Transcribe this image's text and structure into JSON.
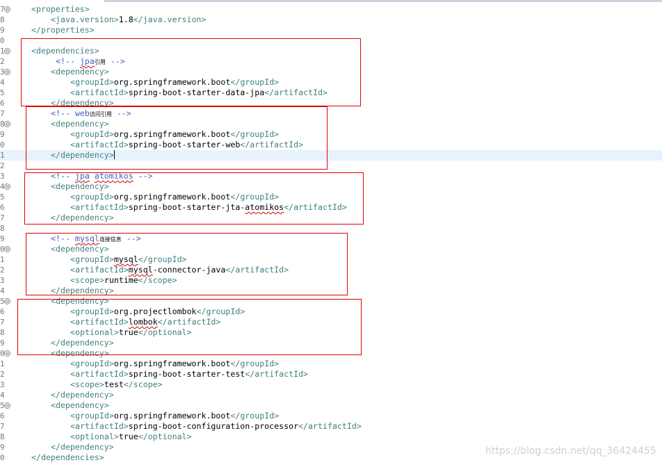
{
  "lines": [
    {
      "ln": "7",
      "fold": true,
      "indent": 0,
      "parts": [
        {
          "k": "tg",
          "t": "<properties>"
        }
      ]
    },
    {
      "ln": "8",
      "indent": 2,
      "parts": [
        {
          "k": "tg",
          "t": "<java.version>"
        },
        {
          "k": "tx",
          "t": "1.8"
        },
        {
          "k": "tg",
          "t": "</java.version>"
        }
      ]
    },
    {
      "ln": "9",
      "indent": 0,
      "parts": [
        {
          "k": "tg",
          "t": "</properties>"
        }
      ]
    },
    {
      "ln": "0",
      "indent": 0,
      "parts": []
    },
    {
      "ln": "1",
      "fold": true,
      "indent": 0,
      "parts": [
        {
          "k": "tg",
          "t": "<dependencies>"
        }
      ]
    },
    {
      "ln": "2",
      "indent": 2.5,
      "parts": [
        {
          "k": "cm",
          "t": "<!-- "
        },
        {
          "k": "cm",
          "t": "jpa",
          "spell": true
        },
        {
          "k": "cj",
          "t": "引用"
        },
        {
          "k": "cm",
          "t": " -->"
        }
      ]
    },
    {
      "ln": "3",
      "fold": true,
      "indent": 2,
      "parts": [
        {
          "k": "tg",
          "t": "<dependency>"
        }
      ]
    },
    {
      "ln": "4",
      "indent": 4,
      "parts": [
        {
          "k": "tg",
          "t": "<groupId>"
        },
        {
          "k": "tx",
          "t": "org.springframework.boot"
        },
        {
          "k": "tg",
          "t": "</groupId>"
        }
      ]
    },
    {
      "ln": "5",
      "indent": 4,
      "parts": [
        {
          "k": "tg",
          "t": "<artifactId>"
        },
        {
          "k": "tx",
          "t": "spring-boot-starter-data-jpa"
        },
        {
          "k": "tg",
          "t": "</artifactId>"
        }
      ]
    },
    {
      "ln": "6",
      "indent": 2,
      "parts": [
        {
          "k": "tg",
          "t": "</dependency>"
        }
      ]
    },
    {
      "ln": "7",
      "indent": 2,
      "parts": [
        {
          "k": "cm",
          "t": "<!-- web"
        },
        {
          "k": "cj",
          "t": "访问引用"
        },
        {
          "k": "cm",
          "t": " -->"
        }
      ]
    },
    {
      "ln": "8",
      "fold": true,
      "indent": 2,
      "parts": [
        {
          "k": "tg",
          "t": "<dependency>"
        }
      ]
    },
    {
      "ln": "9",
      "indent": 4,
      "parts": [
        {
          "k": "tg",
          "t": "<groupId>"
        },
        {
          "k": "tx",
          "t": "org.springframework.boot"
        },
        {
          "k": "tg",
          "t": "</groupId>"
        }
      ]
    },
    {
      "ln": "0",
      "indent": 4,
      "parts": [
        {
          "k": "tg",
          "t": "<artifactId>"
        },
        {
          "k": "tx",
          "t": "spring-boot-starter-web"
        },
        {
          "k": "tg",
          "t": "</artifactId>"
        }
      ]
    },
    {
      "ln": "1",
      "indent": 2,
      "current": true,
      "caret": true,
      "parts": [
        {
          "k": "tg",
          "t": "</dependency>"
        }
      ]
    },
    {
      "ln": "2",
      "indent": 0,
      "parts": []
    },
    {
      "ln": "3",
      "indent": 2,
      "parts": [
        {
          "k": "cm",
          "t": "<!-- "
        },
        {
          "k": "cm",
          "t": "jpa",
          "spell": true
        },
        {
          "k": "cm",
          "t": " "
        },
        {
          "k": "cm",
          "t": "atomikos",
          "spell": true
        },
        {
          "k": "cm",
          "t": " -->"
        }
      ]
    },
    {
      "ln": "4",
      "fold": true,
      "indent": 2,
      "parts": [
        {
          "k": "tg",
          "t": "<dependency>"
        }
      ]
    },
    {
      "ln": "5",
      "indent": 4,
      "parts": [
        {
          "k": "tg",
          "t": "<groupId>"
        },
        {
          "k": "tx",
          "t": "org.springframework.boot"
        },
        {
          "k": "tg",
          "t": "</groupId>"
        }
      ]
    },
    {
      "ln": "6",
      "indent": 4,
      "parts": [
        {
          "k": "tg",
          "t": "<artifactId>"
        },
        {
          "k": "tx",
          "t": "spring-boot-starter-jta-"
        },
        {
          "k": "tx",
          "t": "atomikos",
          "spell": true
        },
        {
          "k": "tg",
          "t": "</artifactId>"
        }
      ]
    },
    {
      "ln": "7",
      "indent": 2,
      "parts": [
        {
          "k": "tg",
          "t": "</dependency>"
        }
      ]
    },
    {
      "ln": "8",
      "indent": 0,
      "parts": []
    },
    {
      "ln": "9",
      "indent": 2,
      "parts": [
        {
          "k": "cm",
          "t": "<!-- "
        },
        {
          "k": "cm",
          "t": "mysql",
          "spell": true
        },
        {
          "k": "cj",
          "t": "连接信息"
        },
        {
          "k": "cm",
          "t": " -->"
        }
      ]
    },
    {
      "ln": "0",
      "fold": true,
      "indent": 2,
      "parts": [
        {
          "k": "tg",
          "t": "<dependency>"
        }
      ]
    },
    {
      "ln": "1",
      "indent": 4,
      "parts": [
        {
          "k": "tg",
          "t": "<groupId>"
        },
        {
          "k": "tx",
          "t": "mysql",
          "spell": true
        },
        {
          "k": "tg",
          "t": "</groupId>"
        }
      ]
    },
    {
      "ln": "2",
      "indent": 4,
      "parts": [
        {
          "k": "tg",
          "t": "<artifactId>"
        },
        {
          "k": "tx",
          "t": "mysql",
          "spell": true
        },
        {
          "k": "tx",
          "t": "-connector-java"
        },
        {
          "k": "tg",
          "t": "</artifactId>"
        }
      ]
    },
    {
      "ln": "3",
      "indent": 4,
      "parts": [
        {
          "k": "tg",
          "t": "<scope>"
        },
        {
          "k": "tx",
          "t": "runtime"
        },
        {
          "k": "tg",
          "t": "</scope>"
        }
      ]
    },
    {
      "ln": "4",
      "indent": 2,
      "parts": [
        {
          "k": "tg",
          "t": "</dependency>"
        }
      ]
    },
    {
      "ln": "5",
      "fold": true,
      "indent": 2,
      "parts": [
        {
          "k": "tg",
          "t": "<dependency>"
        }
      ]
    },
    {
      "ln": "6",
      "indent": 4,
      "parts": [
        {
          "k": "tg",
          "t": "<groupId>"
        },
        {
          "k": "tx",
          "t": "org.projectlombok"
        },
        {
          "k": "tg",
          "t": "</groupId>"
        }
      ]
    },
    {
      "ln": "7",
      "indent": 4,
      "parts": [
        {
          "k": "tg",
          "t": "<artifactId>"
        },
        {
          "k": "tx",
          "t": "lombok",
          "spell": true
        },
        {
          "k": "tg",
          "t": "</artifactId>"
        }
      ]
    },
    {
      "ln": "8",
      "indent": 4,
      "parts": [
        {
          "k": "tg",
          "t": "<optional>"
        },
        {
          "k": "tx",
          "t": "true"
        },
        {
          "k": "tg",
          "t": "</optional>"
        }
      ]
    },
    {
      "ln": "9",
      "indent": 2,
      "parts": [
        {
          "k": "tg",
          "t": "</dependency>"
        }
      ]
    },
    {
      "ln": "0",
      "fold": true,
      "indent": 2,
      "parts": [
        {
          "k": "tg",
          "t": "<dependency>"
        }
      ]
    },
    {
      "ln": "1",
      "indent": 4,
      "parts": [
        {
          "k": "tg",
          "t": "<groupId>"
        },
        {
          "k": "tx",
          "t": "org.springframework.boot"
        },
        {
          "k": "tg",
          "t": "</groupId>"
        }
      ]
    },
    {
      "ln": "2",
      "indent": 4,
      "parts": [
        {
          "k": "tg",
          "t": "<artifactId>"
        },
        {
          "k": "tx",
          "t": "spring-boot-starter-test"
        },
        {
          "k": "tg",
          "t": "</artifactId>"
        }
      ]
    },
    {
      "ln": "3",
      "indent": 4,
      "parts": [
        {
          "k": "tg",
          "t": "<scope>"
        },
        {
          "k": "tx",
          "t": "test"
        },
        {
          "k": "tg",
          "t": "</scope>"
        }
      ]
    },
    {
      "ln": "4",
      "indent": 2,
      "parts": [
        {
          "k": "tg",
          "t": "</dependency>"
        }
      ]
    },
    {
      "ln": "5",
      "fold": true,
      "indent": 2,
      "parts": [
        {
          "k": "tg",
          "t": "<dependency>"
        }
      ]
    },
    {
      "ln": "6",
      "indent": 4,
      "parts": [
        {
          "k": "tg",
          "t": "<groupId>"
        },
        {
          "k": "tx",
          "t": "org.springframework.boot"
        },
        {
          "k": "tg",
          "t": "</groupId>"
        }
      ]
    },
    {
      "ln": "7",
      "indent": 4,
      "parts": [
        {
          "k": "tg",
          "t": "<artifactId>"
        },
        {
          "k": "tx",
          "t": "spring-boot-configuration-processor"
        },
        {
          "k": "tg",
          "t": "</artifactId>"
        }
      ]
    },
    {
      "ln": "8",
      "indent": 4,
      "parts": [
        {
          "k": "tg",
          "t": "<optional>"
        },
        {
          "k": "tx",
          "t": "true"
        },
        {
          "k": "tg",
          "t": "</optional>"
        }
      ]
    },
    {
      "ln": "9",
      "indent": 2,
      "parts": [
        {
          "k": "tg",
          "t": "</dependency>"
        }
      ]
    },
    {
      "ln": "0",
      "indent": 0,
      "parts": [
        {
          "k": "tg",
          "t": "</dependencies>"
        }
      ]
    }
  ],
  "fold_glyph": "⊖",
  "highlight_color": "#e00000",
  "watermark": "https://blog.csdn.net/qq_36424455"
}
